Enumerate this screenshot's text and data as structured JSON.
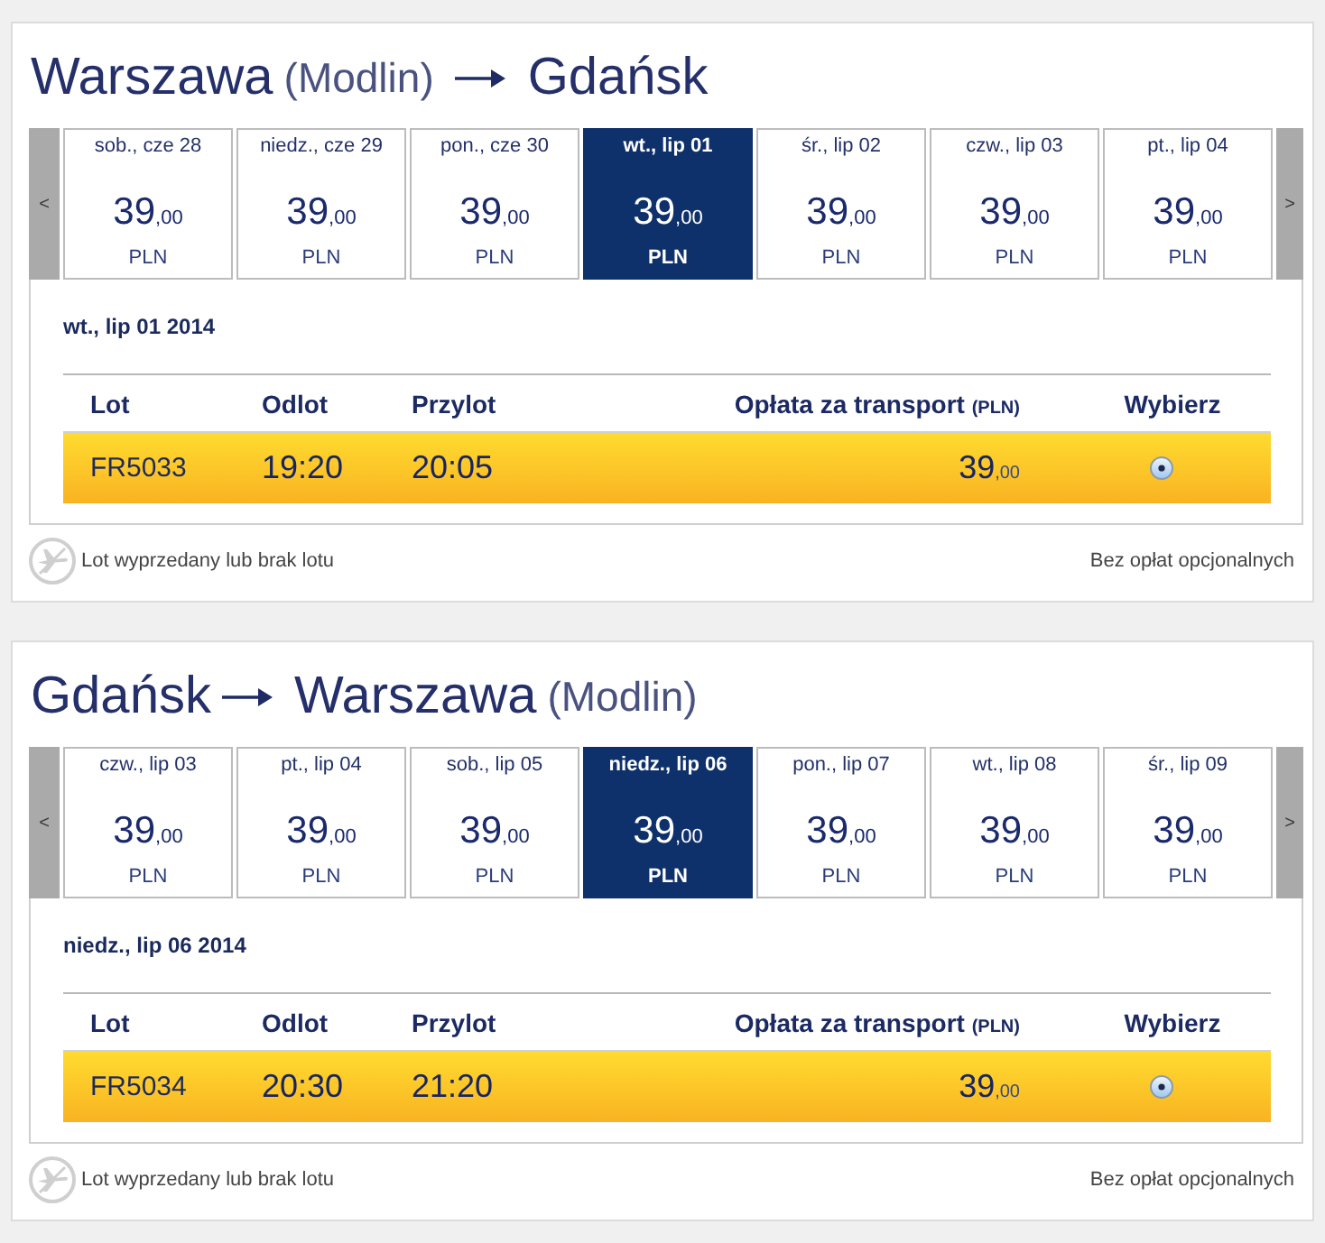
{
  "sections": [
    {
      "origin": {
        "city": "Warszawa",
        "airport": "(Modlin)"
      },
      "destination": {
        "city": "Gdańsk"
      },
      "prev_button": "<",
      "next_button": ">",
      "dates": [
        {
          "label": "sob., cze 28",
          "price": "39",
          "cents": ",00",
          "currency": "PLN",
          "selected": false
        },
        {
          "label": "niedz., cze 29",
          "price": "39",
          "cents": ",00",
          "currency": "PLN",
          "selected": false
        },
        {
          "label": "pon., cze 30",
          "price": "39",
          "cents": ",00",
          "currency": "PLN",
          "selected": false
        },
        {
          "label": "wt., lip 01",
          "price": "39",
          "cents": ",00",
          "currency": "PLN",
          "selected": true
        },
        {
          "label": "śr., lip 02",
          "price": "39",
          "cents": ",00",
          "currency": "PLN",
          "selected": false
        },
        {
          "label": "czw., lip 03",
          "price": "39",
          "cents": ",00",
          "currency": "PLN",
          "selected": false
        },
        {
          "label": "pt., lip 04",
          "price": "39",
          "cents": ",00",
          "currency": "PLN",
          "selected": false
        }
      ],
      "selected_date": "wt., lip 01 2014",
      "columns": [
        {
          "label": "Lot"
        },
        {
          "label": "Odlot"
        },
        {
          "label": "Przylot"
        },
        {
          "label": "Opłata za transport",
          "unit": "(PLN)"
        },
        {
          "label": "Wybierz"
        }
      ],
      "rows": [
        {
          "flight": "FR5033",
          "departure": "19:20",
          "arrival": "20:05",
          "price": "39",
          "cents": ",00",
          "selected": true
        }
      ],
      "legend": "Lot wyprzedany lub brak lotu",
      "note": "Bez opłat opcjonalnych"
    },
    {
      "origin": {
        "city": "Gdańsk"
      },
      "destination": {
        "city": "Warszawa",
        "airport": "(Modlin)"
      },
      "prev_button": "<",
      "next_button": ">",
      "dates": [
        {
          "label": "czw., lip 03",
          "price": "39",
          "cents": ",00",
          "currency": "PLN",
          "selected": false
        },
        {
          "label": "pt., lip 04",
          "price": "39",
          "cents": ",00",
          "currency": "PLN",
          "selected": false
        },
        {
          "label": "sob., lip 05",
          "price": "39",
          "cents": ",00",
          "currency": "PLN",
          "selected": false
        },
        {
          "label": "niedz., lip 06",
          "price": "39",
          "cents": ",00",
          "currency": "PLN",
          "selected": true
        },
        {
          "label": "pon., lip 07",
          "price": "39",
          "cents": ",00",
          "currency": "PLN",
          "selected": false
        },
        {
          "label": "wt., lip 08",
          "price": "39",
          "cents": ",00",
          "currency": "PLN",
          "selected": false
        },
        {
          "label": "śr., lip 09",
          "price": "39",
          "cents": ",00",
          "currency": "PLN",
          "selected": false
        }
      ],
      "selected_date": "niedz., lip 06 2014",
      "columns": [
        {
          "label": "Lot"
        },
        {
          "label": "Odlot"
        },
        {
          "label": "Przylot"
        },
        {
          "label": "Opłata za transport",
          "unit": "(PLN)"
        },
        {
          "label": "Wybierz"
        }
      ],
      "rows": [
        {
          "flight": "FR5034",
          "departure": "20:30",
          "arrival": "21:20",
          "price": "39",
          "cents": ",00",
          "selected": true
        }
      ],
      "legend": "Lot wyprzedany lub brak lotu",
      "note": "Bez opłat opcjonalnych"
    }
  ]
}
